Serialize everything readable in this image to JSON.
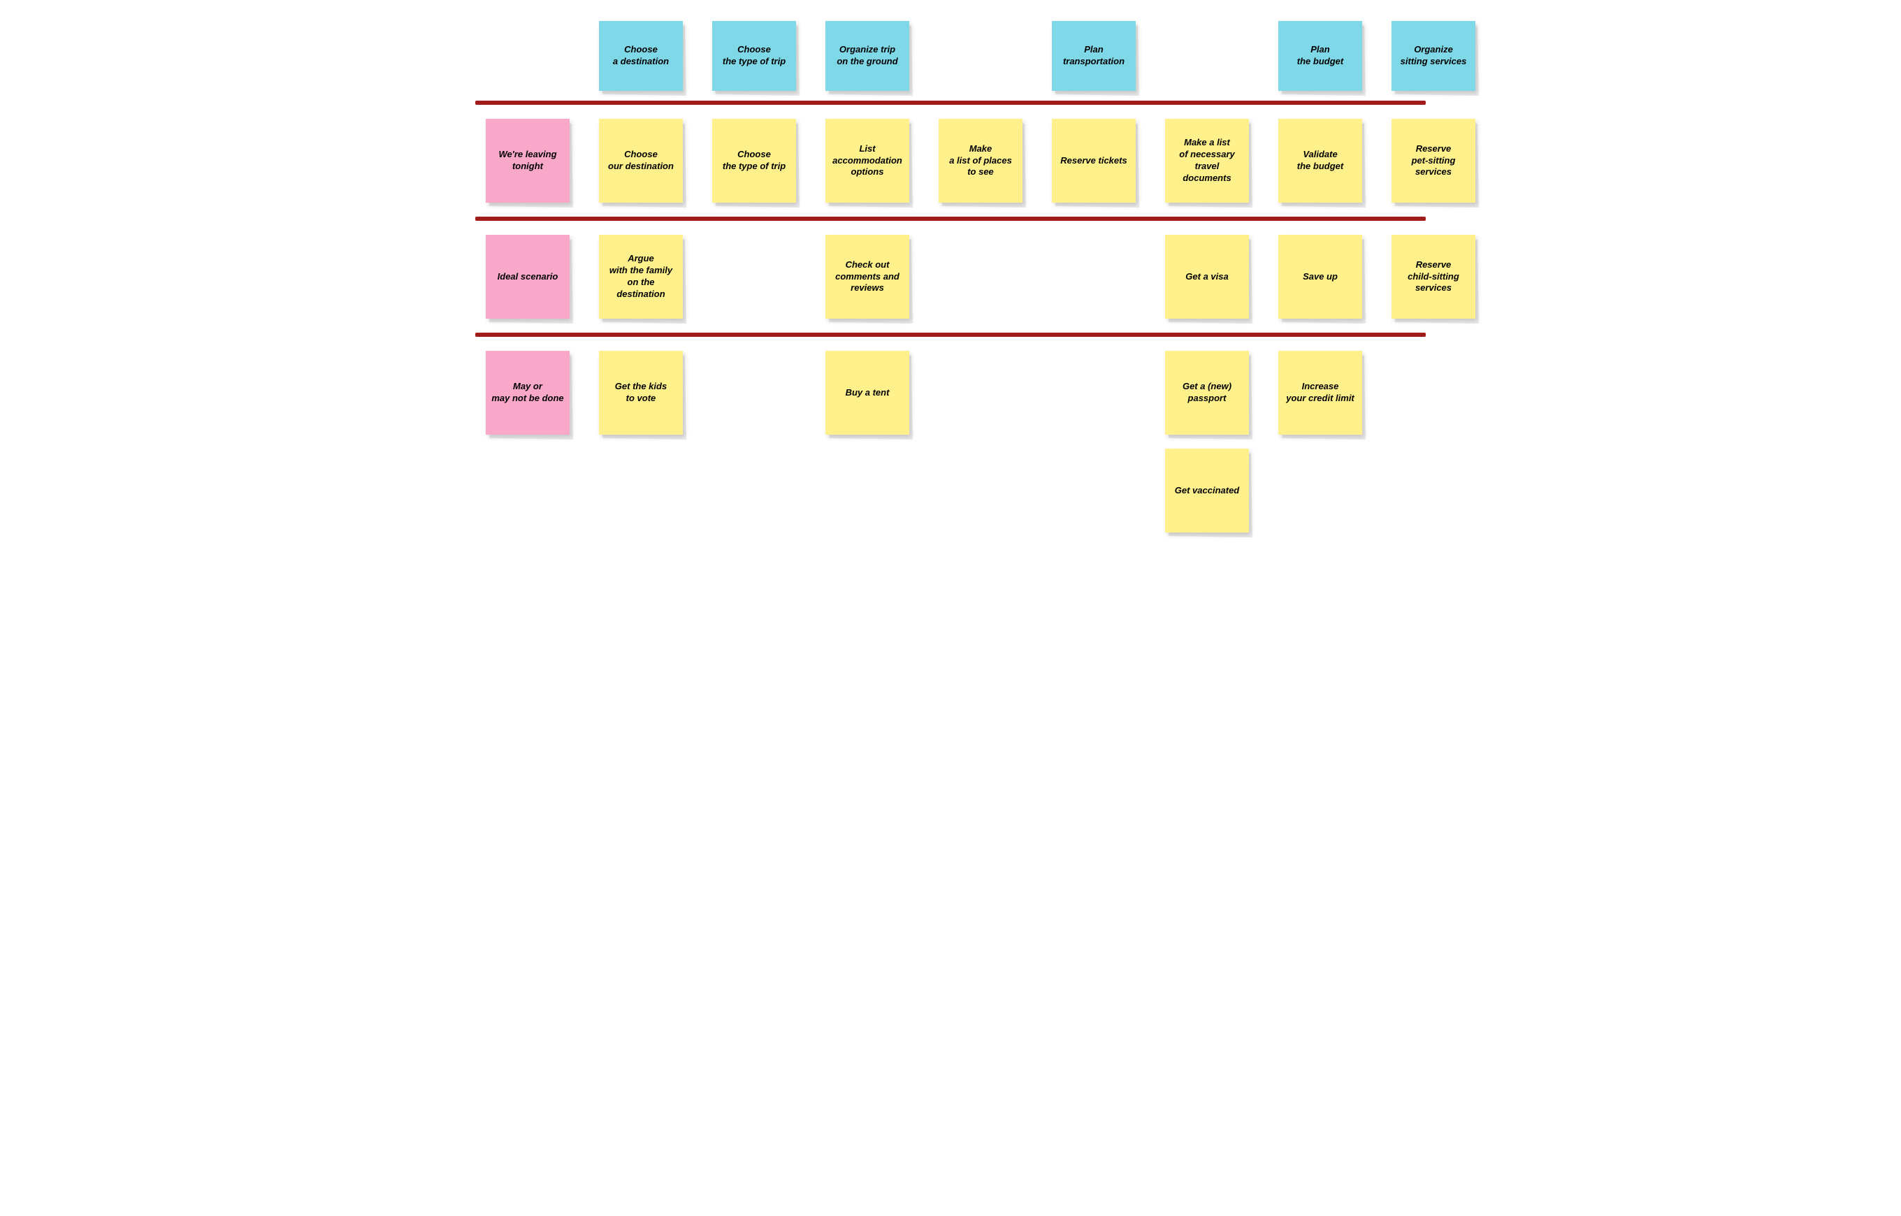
{
  "colors": {
    "blue": "#7fd8e8",
    "yellow": "#fef08a",
    "pink": "#f9a8c9",
    "separator": "#a31c1c"
  },
  "header": {
    "notes": [
      {
        "col": 1,
        "text": "Choose\na destination",
        "color": "blue"
      },
      {
        "col": 2,
        "text": "Choose\nthe type of trip",
        "color": "blue"
      },
      {
        "col": 3,
        "text": "Organize trip\non the ground",
        "color": "blue"
      },
      {
        "col": 4,
        "text": "",
        "color": null
      },
      {
        "col": 5,
        "text": "Plan\ntransportation",
        "color": "blue"
      },
      {
        "col": 6,
        "text": "",
        "color": null
      },
      {
        "col": 7,
        "text": "Plan\nthe budget",
        "color": "blue"
      },
      {
        "col": 8,
        "text": "Organize\nsitting services",
        "color": "blue"
      }
    ]
  },
  "rows": [
    {
      "id": "row1",
      "label": {
        "text": "We're leaving\ntonight",
        "color": "pink"
      },
      "cells": [
        {
          "text": "Choose\nour destination",
          "color": "yellow"
        },
        {
          "text": "Choose\nthe type of trip",
          "color": "yellow"
        },
        {
          "text": "List\naccommodation\noptions",
          "color": "yellow"
        },
        {
          "text": "Make\na list of places\nto see",
          "color": "yellow"
        },
        {
          "text": "Reserve tickets",
          "color": "yellow"
        },
        {
          "text": "Make a list\nof necessary\ntravel documents",
          "color": "yellow"
        },
        {
          "text": "Validate\nthe budget",
          "color": "yellow"
        },
        {
          "text": "Reserve\npet-sitting\nservices",
          "color": "yellow"
        }
      ]
    },
    {
      "id": "row2",
      "label": {
        "text": "Ideal scenario",
        "color": "pink"
      },
      "cells": [
        {
          "text": "Argue\nwith the family\non the destination",
          "color": "yellow"
        },
        {
          "text": "",
          "color": null
        },
        {
          "text": "Check out\ncomments and\nreviews",
          "color": "yellow"
        },
        {
          "text": "",
          "color": null
        },
        {
          "text": "",
          "color": null
        },
        {
          "text": "Get a visa",
          "color": "yellow"
        },
        {
          "text": "Save up",
          "color": "yellow"
        },
        {
          "text": "Reserve\nchild-sitting\nservices",
          "color": "yellow"
        }
      ]
    },
    {
      "id": "row3",
      "label": {
        "text": "May or\nmay not be done",
        "color": "pink"
      },
      "cells": [
        {
          "text": "Get the kids\nto vote",
          "color": "yellow"
        },
        {
          "text": "",
          "color": null
        },
        {
          "text": "Buy a tent",
          "color": "yellow"
        },
        {
          "text": "",
          "color": null
        },
        {
          "text": "",
          "color": null
        },
        {
          "text": "Get a (new)\npassport",
          "color": "yellow"
        },
        {
          "text": "Increase\nyour credit limit",
          "color": "yellow"
        },
        {
          "text": "",
          "color": null
        }
      ]
    },
    {
      "id": "row4",
      "label": null,
      "cells": [
        {
          "text": "",
          "color": null
        },
        {
          "text": "",
          "color": null
        },
        {
          "text": "",
          "color": null
        },
        {
          "text": "",
          "color": null
        },
        {
          "text": "",
          "color": null
        },
        {
          "text": "Get vaccinated",
          "color": "yellow"
        },
        {
          "text": "",
          "color": null
        },
        {
          "text": "",
          "color": null
        }
      ]
    }
  ]
}
